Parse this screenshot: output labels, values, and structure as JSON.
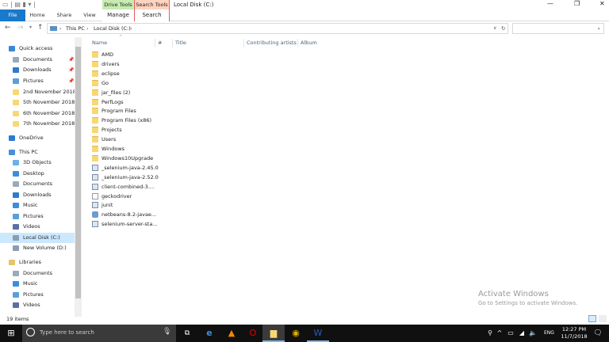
{
  "window": {
    "title": "Local Disk (C:)"
  },
  "ribbon": {
    "file": "File",
    "tabs": [
      "Home",
      "Share",
      "View"
    ],
    "drive_tools": {
      "header": "Drive Tools",
      "tab": "Manage",
      "color": "#c7ebb0"
    },
    "search_tools": {
      "header": "Search Tools",
      "tab": "Search",
      "color": "#ffd3bf",
      "border": "#e06060"
    }
  },
  "address": {
    "crumbs": [
      "This PC",
      "Local Disk (C:)"
    ],
    "search_placeholder": ""
  },
  "columns": [
    "Name",
    "#",
    "Title",
    "Contributing artists",
    "Album"
  ],
  "sidebar": [
    {
      "label": "Quick access",
      "icon": "star-icon",
      "level": 0
    },
    {
      "label": "Documents",
      "icon": "documents-icon",
      "level": 1,
      "pinned": true
    },
    {
      "label": "Downloads",
      "icon": "downloads-icon",
      "level": 1,
      "pinned": true
    },
    {
      "label": "Pictures",
      "icon": "pictures-icon",
      "level": 1,
      "pinned": true
    },
    {
      "label": "2nd November 2018",
      "icon": "folder-icon",
      "level": 1
    },
    {
      "label": "5th November 2018",
      "icon": "folder-icon",
      "level": 1
    },
    {
      "label": "6th November 2018",
      "icon": "folder-icon",
      "level": 1
    },
    {
      "label": "7th November 2018",
      "icon": "folder-icon",
      "level": 1
    },
    {
      "label": "OneDrive",
      "icon": "cloud-icon",
      "level": 0
    },
    {
      "label": "This PC",
      "icon": "computer-icon",
      "level": 0
    },
    {
      "label": "3D Objects",
      "icon": "3d-objects-icon",
      "level": 1
    },
    {
      "label": "Desktop",
      "icon": "desktop-icon",
      "level": 1
    },
    {
      "label": "Documents",
      "icon": "documents-icon",
      "level": 1
    },
    {
      "label": "Downloads",
      "icon": "downloads-icon",
      "level": 1
    },
    {
      "label": "Music",
      "icon": "music-icon",
      "level": 1
    },
    {
      "label": "Pictures",
      "icon": "pictures-icon",
      "level": 1
    },
    {
      "label": "Videos",
      "icon": "videos-icon",
      "level": 1
    },
    {
      "label": "Local Disk (C:)",
      "icon": "drive-icon",
      "level": 1,
      "selected": true
    },
    {
      "label": "New Volume (D:)",
      "icon": "drive-icon",
      "level": 1
    },
    {
      "label": "Libraries",
      "icon": "libraries-icon",
      "level": 0
    },
    {
      "label": "Documents",
      "icon": "documents-icon",
      "level": 1
    },
    {
      "label": "Music",
      "icon": "music-icon",
      "level": 1
    },
    {
      "label": "Pictures",
      "icon": "pictures-icon",
      "level": 1
    },
    {
      "label": "Videos",
      "icon": "videos-icon",
      "level": 1
    }
  ],
  "files": [
    {
      "name": "AMD",
      "type": "folder"
    },
    {
      "name": "drivers",
      "type": "folder"
    },
    {
      "name": "eclipse",
      "type": "folder"
    },
    {
      "name": "Go",
      "type": "folder"
    },
    {
      "name": "jar_files (2)",
      "type": "folder"
    },
    {
      "name": "PerfLogs",
      "type": "folder"
    },
    {
      "name": "Program Files",
      "type": "folder"
    },
    {
      "name": "Program Files (x86)",
      "type": "folder"
    },
    {
      "name": "Projects",
      "type": "folder"
    },
    {
      "name": "Users",
      "type": "folder"
    },
    {
      "name": "Windows",
      "type": "folder"
    },
    {
      "name": "Windows10Upgrade",
      "type": "folder"
    },
    {
      "name": "_selenium-java-2.45.0",
      "type": "jar"
    },
    {
      "name": "_selenium-java-2.52.0",
      "type": "jar"
    },
    {
      "name": "client-combined-3....",
      "type": "jar"
    },
    {
      "name": "geckodriver",
      "type": "file"
    },
    {
      "name": "junit",
      "type": "jar"
    },
    {
      "name": "netbeans-8.2-javae...",
      "type": "installer"
    },
    {
      "name": "selenium-server-sta...",
      "type": "jar"
    }
  ],
  "status": {
    "items": "19 items"
  },
  "watermark": {
    "title": "Activate Windows",
    "subtitle": "Go to Settings to activate Windows."
  },
  "taskbar": {
    "search_placeholder": "Type here to search",
    "time": "12:27 PM",
    "date": "11/7/2018",
    "lang": "ENG"
  }
}
